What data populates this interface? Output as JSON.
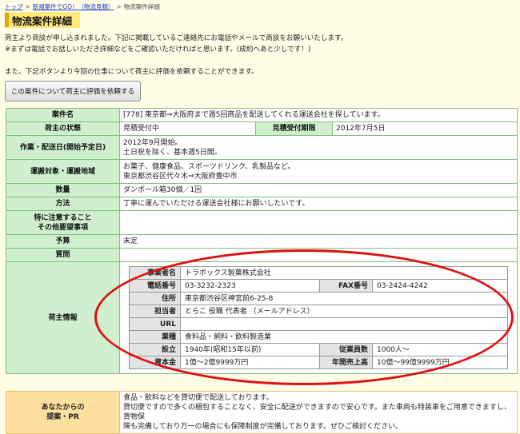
{
  "breadcrumb": {
    "home": "トップ",
    "parent": "新規案件でGO！（物流見積）",
    "current": "物流案件詳細",
    "separator": ">"
  },
  "page_title": "物流案件詳細",
  "intro": {
    "line1": "荷主より商談が申し込まれました。下記に掲載しているご連絡先にお電話やメールで商談をお願いいたします。",
    "line2": "※まずは電話でお話しいただき詳細などをご確認いただければと思います。(成約へあと少しです！)",
    "line3": "また、下記ボタンより今回の仕事について荷主に評価を依頼することができます。"
  },
  "eval_button_label": "この案件について荷主に評価を依頼する",
  "details": {
    "case_name_label": "案件名",
    "case_name_value": "[778] 東京都⇒大阪府まで週5回商品を配送してくれる運送会社を探しています。",
    "status_label": "荷主の状態",
    "status_value": "見積受付中",
    "deadline_label": "見積受付期限",
    "deadline_value": "2012年7月5日",
    "period_label": "作業・配送日(開始予定日)",
    "period_line1": "2012年9月開始。",
    "period_line2": "土日祝を除く、基本週5日間。",
    "target_label": "運搬対象・運搬地域",
    "target_line1": "お菓子、健康食品、スポーツドリンク、乳製品など。",
    "target_line2": "東京都渋谷区代々木⇒大阪府豊中市",
    "quantity_label": "数量",
    "quantity_value": "ダンボール箱30個／1回",
    "method_label": "方法",
    "method_value": "丁寧に運んでいただける運送会社様にお願いしたいです。",
    "notes_label_line1": "特に注意すること",
    "notes_label_line2": "その他要望事項",
    "notes_value": "",
    "budget_label": "予算",
    "budget_value": "未定",
    "question_label": "質問",
    "question_value": "",
    "shipper_label": "荷主情報"
  },
  "shipper": {
    "company_label": "事業者名",
    "company_value": "トラボックス製菓株式会社",
    "phone_label": "電話番号",
    "phone_value": "03-3232-2323",
    "fax_label": "FAX番号",
    "fax_value": "03-2424-4242",
    "address_label": "住所",
    "address_value": "東京都渋谷区神宮前6-25-8",
    "contact_label": "担当者",
    "contact_value": "とらこ 役職 代表者 （メールアドレス）",
    "url_label": "URL",
    "url_value": "",
    "industry_label": "業種",
    "industry_value": "食料品・飼料・飲料製造業",
    "founded_label": "設立",
    "founded_value": "1940年(昭和15年以前)",
    "employees_label": "従業員数",
    "employees_value": "1000人～",
    "capital_label": "資本金",
    "capital_value": "1億～2億9999万円",
    "sales_label": "年間売上高",
    "sales_value": "10億～99億9999万円"
  },
  "pr": {
    "label_line1": "あなたからの",
    "label_line2": "提案・PR",
    "line1": "食品・飲料などを貸切便で配送しております。",
    "line2": "貸切便ですので多くの梱包することなく、安全に配送ができますので安心です。また車両も特装車をご用意できますし、貨物保",
    "line3": "険も完備しており万一の場合にも保障制度が完備しております。ぜひご検討ください。"
  },
  "colors": {
    "table_border": "#7fc07f",
    "label_bg": "#cfefcf",
    "annotation_ellipse": "#e01010",
    "pr_label_bg": "#ffe0a0"
  }
}
